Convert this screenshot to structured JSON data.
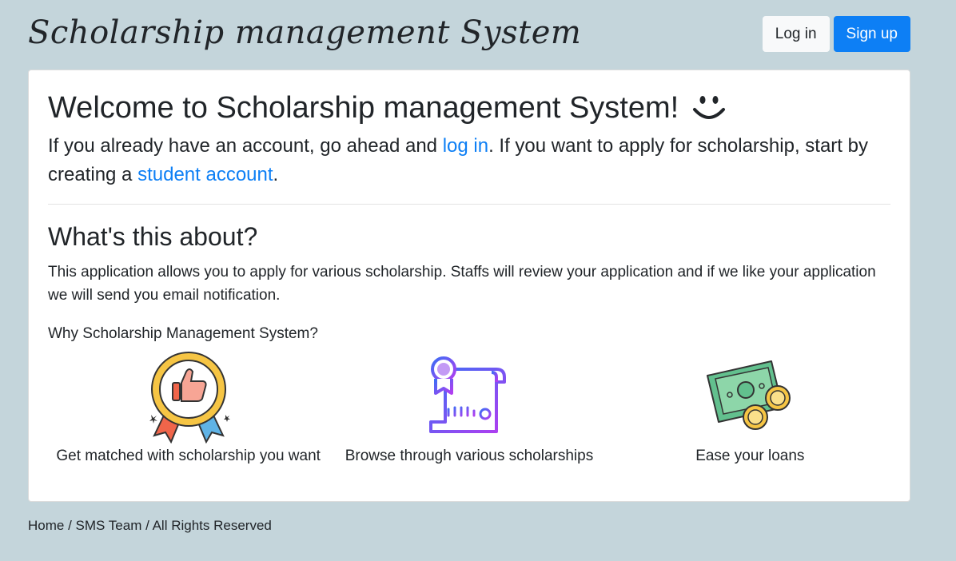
{
  "header": {
    "brand": "Scholarship management System",
    "login_label": "Log in",
    "signup_label": "Sign up"
  },
  "main": {
    "welcome_title": "Welcome to Scholarship management System!",
    "intro_part1": "If you already have an account, go ahead and ",
    "intro_login_link": "log in",
    "intro_part2": ". If you want to apply for scholarship, start by creating a ",
    "intro_signup_link": "student account",
    "intro_part3": ".",
    "about_heading": "What's this about?",
    "about_text": "This application allows you to apply for various scholarship. Staffs will review your application and if we like your application we will send you email notification.",
    "why_text": "Why Scholarship Management System?",
    "features": [
      {
        "icon": "award-thumbs-up-icon",
        "caption": "Get matched with scholarship you want"
      },
      {
        "icon": "certificate-scroll-icon",
        "caption": "Browse through various scholarships"
      },
      {
        "icon": "money-coins-icon",
        "caption": "Ease your loans"
      }
    ]
  },
  "footer": {
    "home": "Home",
    "sep1": " / ",
    "team": "SMS Team",
    "sep2": " / ",
    "rights": "All Rights Reserved"
  },
  "colors": {
    "background": "#c4d5db",
    "primary": "#0d7ff5",
    "link": "#0d7ff5"
  }
}
